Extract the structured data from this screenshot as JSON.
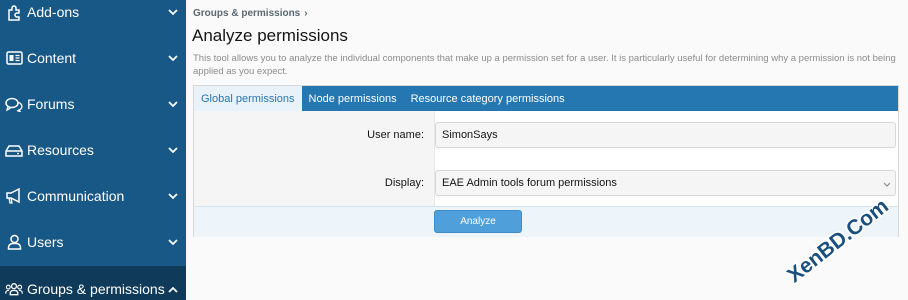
{
  "sidebar": {
    "items": [
      {
        "label": "Add-ons",
        "icon": "puzzle-icon",
        "expanded": false
      },
      {
        "label": "Content",
        "icon": "content-icon",
        "expanded": false
      },
      {
        "label": "Forums",
        "icon": "comments-icon",
        "expanded": false
      },
      {
        "label": "Resources",
        "icon": "hdd-icon",
        "expanded": false
      },
      {
        "label": "Communication",
        "icon": "bullhorn-icon",
        "expanded": false
      },
      {
        "label": "Users",
        "icon": "user-icon",
        "expanded": false
      },
      {
        "label": "Groups & permissions",
        "icon": "users-icon",
        "expanded": true
      }
    ]
  },
  "breadcrumb": {
    "label": "Groups & permissions",
    "sep": "›"
  },
  "page": {
    "title": "Analyze permissions",
    "description": "This tool allows you to analyze the individual components that make up a permission set for a user. It is particularly useful for determining why a permission is not being applied as you expect."
  },
  "tabs": [
    {
      "label": "Global permissions",
      "active": true
    },
    {
      "label": "Node permissions",
      "active": false
    },
    {
      "label": "Resource category permissions",
      "active": false
    }
  ],
  "form": {
    "username_label": "User name:",
    "username_value": "SimonSays",
    "display_label": "Display:",
    "display_value": "EAE Admin tools forum permissions",
    "submit_label": "Analyze"
  },
  "watermark": {
    "text": "XenBD.Com"
  },
  "colors": {
    "sidebar": "#185886",
    "accent": "#2577b1",
    "button": "#4f9fdb"
  }
}
